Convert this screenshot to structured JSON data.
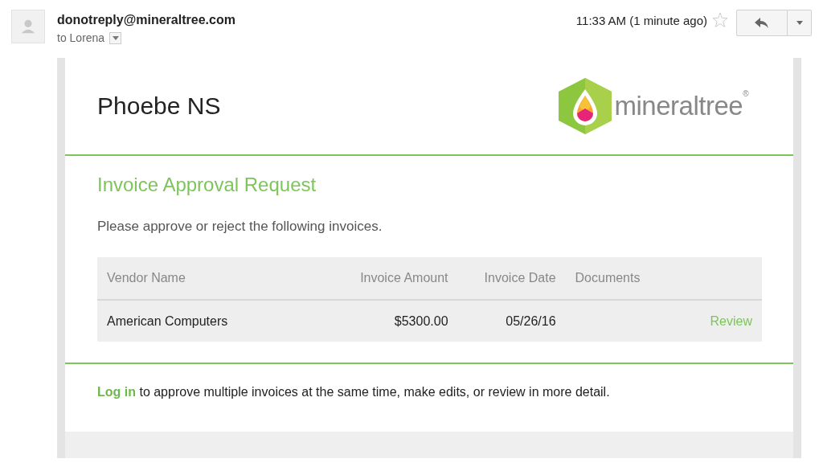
{
  "email_header": {
    "sender": "donotreply@mineraltree.com",
    "recipient": "to Lorena",
    "time": "11:33 AM (1 minute ago)"
  },
  "message": {
    "company": "Phoebe NS",
    "logo_text": "mineraltree$^{®}$",
    "title": "Invoice Approval Request",
    "intro": "Please approve or reject the following invoices.",
    "table": {
      "columns": [
        "Vendor Name",
        "Invoice Amount",
        "Invoice Date",
        "Documents"
      ],
      "rows": [
        {
          "vendor": "American Computers",
          "amount": "$5300.00",
          "date": "05/26/16",
          "action": "Review"
        }
      ]
    },
    "footer": {
      "link": "Log in",
      "text": " to approve multiple invoices at the same time, make edits, or review in more detail."
    }
  }
}
